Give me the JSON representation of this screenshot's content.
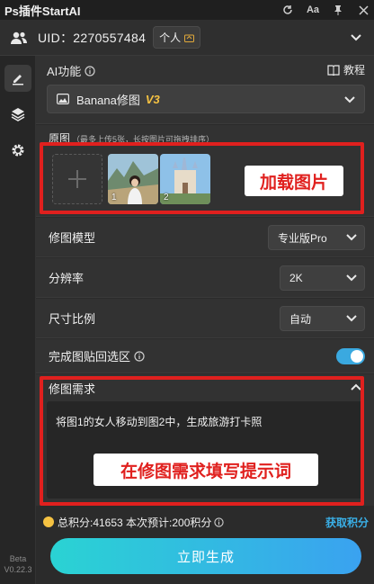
{
  "app": {
    "title": "Ps插件StartAI"
  },
  "titlebar": {
    "refresh_icon": "refresh-icon",
    "font_label": "Aa",
    "pin_icon": "pin-icon",
    "close_icon": "close-icon"
  },
  "user": {
    "uid_label": "UID：2270557484",
    "account_type": "个人"
  },
  "ai": {
    "label": "AI功能",
    "tutorial": "教程",
    "model_name": "Banana修图",
    "model_version": "V3"
  },
  "original": {
    "label": "原图",
    "hint": "（最多上传5张，长按图片可拖拽排序）",
    "thumbs": [
      {
        "num": "1"
      },
      {
        "num": "2"
      }
    ],
    "overlay": "加载图片"
  },
  "settings": {
    "model": {
      "label": "修图模型",
      "value": "专业版Pro"
    },
    "resolution": {
      "label": "分辨率",
      "value": "2K"
    },
    "ratio": {
      "label": "尺寸比例",
      "value": "自动"
    },
    "paste_back": {
      "label": "完成图贴回选区",
      "enabled": true
    }
  },
  "request": {
    "label": "修图需求",
    "text": "将图1的女人移动到图2中，生成旅游打卡照",
    "overlay": "在修图需求填写提示词"
  },
  "footer": {
    "points_text": "总积分:41653  本次预计:200积分",
    "get_points": "获取积分",
    "generate": "立即生成",
    "beta": "Beta",
    "version": "V0.22.3"
  },
  "colors": {
    "accent": "#3ab0e8",
    "highlight": "#e0201e",
    "version_tag": "#f5c242"
  }
}
